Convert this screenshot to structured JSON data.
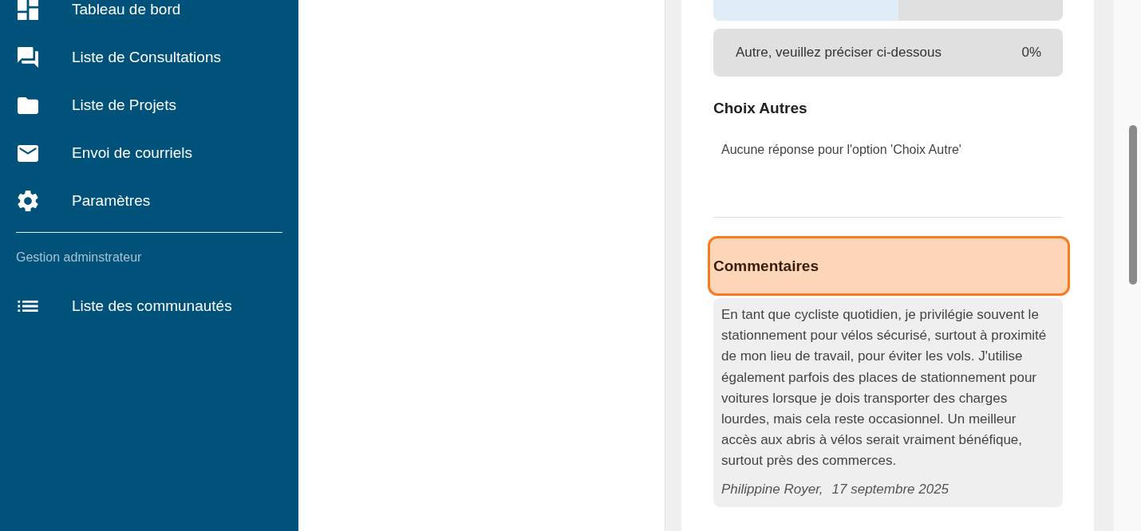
{
  "sidebar": {
    "items": [
      {
        "label": "Tableau de bord",
        "selected": false
      },
      {
        "label": "Liste de Consultations",
        "selected": false
      },
      {
        "label": "Liste de Projets",
        "selected": false
      },
      {
        "label": "Envoi de courriels",
        "selected": false
      },
      {
        "label": "Paramètres",
        "selected": false
      }
    ],
    "section_label": "Gestion adminstrateur",
    "admin_items": [
      {
        "label": "Liste des communautés",
        "selected": false
      }
    ]
  },
  "results": {
    "options": [
      {
        "level": 0.53
      },
      {
        "label": "Autre, veuillez préciser ci-dessous",
        "percent": "0%"
      }
    ],
    "other_choices": {
      "title": "Choix Autres",
      "empty_message": "Aucune réponse pour l'option 'Choix Autre'"
    },
    "comments": {
      "title": "Commentaires",
      "highlighted": true,
      "items": [
        {
          "text": "En tant que cycliste quotidien, je privilégie souvent le stationnement pour vélos sécurisé, surtout à proximité de mon lieu de travail, pour éviter les vols. J'utilise également parfois des places de stationnement pour voitures lorsque je dois transporter des charges lourdes, mais cela reste occasionnel. Un meilleur accès aux abris à vélos serait vraiment bénéfique, surtout près des commerces.",
          "author": "Philippine Royer,",
          "date": "17 septembre 2025"
        }
      ]
    }
  }
}
